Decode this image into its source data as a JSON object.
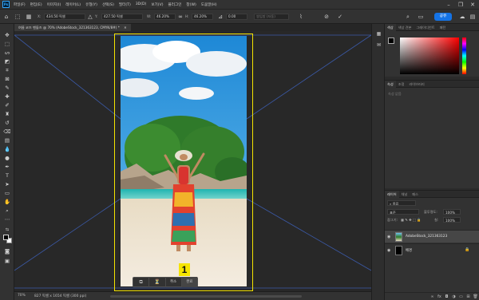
{
  "menu": {
    "items": [
      "파일(F)",
      "편집(E)",
      "이미지(I)",
      "레이어(L)",
      "유형(Y)",
      "선택(S)",
      "필터(T)",
      "3D(D)",
      "보기(V)",
      "플러그인",
      "창(W)",
      "도움말(H)"
    ],
    "app_icon": "Ps"
  },
  "options": {
    "x_label": "X:",
    "x_value": "434.50 픽셀",
    "y_label": "Y:",
    "y_value": "427.50 픽셀",
    "w_label": "W:",
    "w_value": "46.20%",
    "h_label": "H:",
    "h_value": "46.20%",
    "angle_value": "0.00",
    "interp_value": "쌍입방 (자동)",
    "share_label": "공유"
  },
  "document": {
    "tab_title": "여름 코즈 벤들즈 @ 70% (AdobeStock_321363123, CMYK/8#) *"
  },
  "context_bar": {
    "items": [
      "⧉",
      "⏳",
      "취소",
      "완료"
    ]
  },
  "callout": {
    "label": "1"
  },
  "status": {
    "zoom": "70%",
    "doc_info": "827 픽셀 x 1654 픽셀 (300 ppi)"
  },
  "color_panel": {
    "tabs": [
      "색상",
      "색상 견본",
      "그레이디언트",
      "패턴"
    ]
  },
  "properties_panel": {
    "tabs": [
      "속성",
      "조정",
      "라이브러리"
    ],
    "placeholder": "속성 없음"
  },
  "layers_panel": {
    "tabs": [
      "레이어",
      "채널",
      "패스"
    ],
    "kind_label": "종류",
    "blend_mode": "표준",
    "opacity_label": "불투명도:",
    "opacity_value": "100%",
    "lock_label": "잠그기:",
    "fill_label": "칠:",
    "fill_value": "100%",
    "layers": [
      {
        "name": "AdobeStock_321363123",
        "selected": true
      },
      {
        "name": "배경",
        "selected": false
      }
    ]
  },
  "colors": {
    "accent": "#1473e6",
    "artboard_outline": "#f5e400",
    "callout_bg": "#f5e400"
  }
}
